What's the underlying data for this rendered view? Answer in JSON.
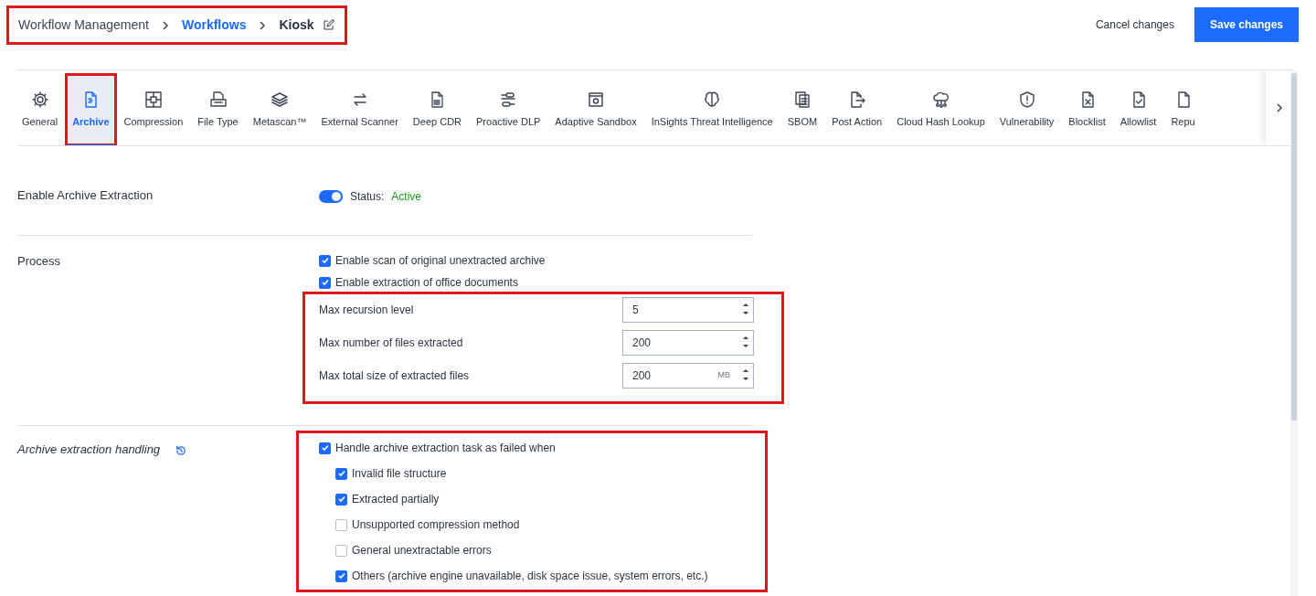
{
  "breadcrumb": {
    "highlighted": true,
    "items": [
      {
        "label": "Workflow Management",
        "kind": "plain"
      },
      {
        "label": "Workflows",
        "kind": "link"
      },
      {
        "label": "Kiosk",
        "kind": "current"
      }
    ]
  },
  "actions": {
    "cancel": "Cancel changes",
    "save": "Save changes"
  },
  "tabs": [
    {
      "label": "General",
      "selected": false,
      "highlighted": false
    },
    {
      "label": "Archive",
      "selected": true,
      "highlighted": true
    },
    {
      "label": "Compression",
      "selected": false,
      "highlighted": false
    },
    {
      "label": "File Type",
      "selected": false,
      "highlighted": false
    },
    {
      "label": "Metascan™",
      "selected": false,
      "highlighted": false
    },
    {
      "label": "External Scanner",
      "selected": false,
      "highlighted": false
    },
    {
      "label": "Deep CDR",
      "selected": false,
      "highlighted": false
    },
    {
      "label": "Proactive DLP",
      "selected": false,
      "highlighted": false
    },
    {
      "label": "Adaptive Sandbox",
      "selected": false,
      "highlighted": false
    },
    {
      "label": "InSights Threat Intelligence",
      "selected": false,
      "highlighted": false
    },
    {
      "label": "SBOM",
      "selected": false,
      "highlighted": false
    },
    {
      "label": "Post Action",
      "selected": false,
      "highlighted": false
    },
    {
      "label": "Cloud Hash Lookup",
      "selected": false,
      "highlighted": false
    },
    {
      "label": "Vulnerability",
      "selected": false,
      "highlighted": false
    },
    {
      "label": "Blocklist",
      "selected": false,
      "highlighted": false
    },
    {
      "label": "Allowlist",
      "selected": false,
      "highlighted": false
    },
    {
      "label": "Repu",
      "selected": false,
      "highlighted": false
    }
  ],
  "enable": {
    "label": "Enable Archive Extraction",
    "on": true,
    "status_label": "Status:",
    "status_value": "Active"
  },
  "process": {
    "label": "Process",
    "checks": [
      {
        "label": "Enable scan of original unextracted archive",
        "checked": true
      },
      {
        "label": "Enable extraction of office documents",
        "checked": true
      }
    ],
    "numbers_highlighted": true,
    "numbers": [
      {
        "label": "Max recursion level",
        "value": "5"
      },
      {
        "label": "Max number of files extracted",
        "value": "200"
      },
      {
        "label": "Max total size of extracted files",
        "value": "200",
        "unit": "MB"
      }
    ]
  },
  "handling": {
    "label": "Archive extraction handling",
    "highlighted": true,
    "main": {
      "label": "Handle archive extraction task as failed when",
      "checked": true
    },
    "children": [
      {
        "label": "Invalid file structure",
        "checked": true
      },
      {
        "label": "Extracted partially",
        "checked": true
      },
      {
        "label": "Unsupported compression method",
        "checked": false
      },
      {
        "label": "General unextractable errors",
        "checked": false
      },
      {
        "label": "Others (archive engine unavailable, disk space issue, system errors, etc.)",
        "checked": true
      }
    ]
  }
}
